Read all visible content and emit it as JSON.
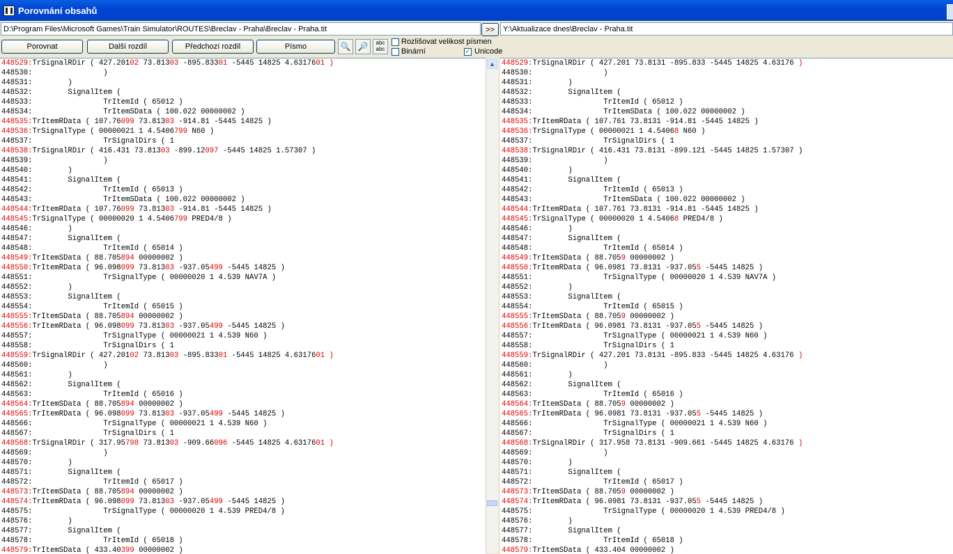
{
  "title": "Porovnání obsahů",
  "left_path": "D:\\Program Files\\Microsoft Games\\Train Simulator\\ROUTES\\Breclav - Praha\\Breclav - Praha.tit",
  "copy_button": ">>",
  "right_path": "Y:\\Aktualizace dnes\\Breclav - Praha.tit",
  "toolbar": {
    "compare": "Porovnat",
    "next_diff": "Další rozdíl",
    "prev_diff": "Předchozí rozdíl",
    "font": "Písmo",
    "case_sensitive_label": "Rozlišovat velikost písmen",
    "binary_label": "Binární",
    "unicode_label": "Unicode",
    "unicode_checked": true,
    "case_checked": false,
    "binary_checked": false
  },
  "icons": [
    "binoculars-icon",
    "binoculars-next-icon",
    "text-compare-icon"
  ],
  "left_lines": [
    [
      [
        "448529:",
        "d"
      ],
      [
        "TrSignalRDir ( 427.201",
        ""
      ],
      [
        "02",
        "d"
      ],
      [
        " 73.813",
        ""
      ],
      [
        "03",
        "d"
      ],
      [
        " -895.833",
        ""
      ],
      [
        "01",
        "d"
      ],
      [
        " -5445 14825 4.63176",
        ""
      ],
      [
        "01 )",
        "d"
      ]
    ],
    [
      [
        "448530:                ) ",
        ""
      ]
    ],
    [
      [
        "448531:        ) ",
        ""
      ]
    ],
    [
      [
        "448532:        SignalItem ( ",
        ""
      ]
    ],
    [
      [
        "448533:                TrItemId ( 65012 ) ",
        ""
      ]
    ],
    [
      [
        "448534:                TrItemSData ( 100.022 00000002 ) ",
        ""
      ]
    ],
    [
      [
        "448535:",
        "d"
      ],
      [
        "TrItemRData ( 107.76",
        ""
      ],
      [
        "099",
        "d"
      ],
      [
        " 73.813",
        ""
      ],
      [
        "03",
        "d"
      ],
      [
        " -914.81 -5445 14825 ) ",
        ""
      ]
    ],
    [
      [
        "448536:",
        "d"
      ],
      [
        "TrSignalType ( 00000021 1 4.5406",
        ""
      ],
      [
        "799",
        "d"
      ],
      [
        " N60 ) ",
        ""
      ]
    ],
    [
      [
        "448537:                TrSignalDirs ( 1",
        ""
      ]
    ],
    [
      [
        "448538:",
        "d"
      ],
      [
        "TrSignalRDir ( 416.431 73.813",
        ""
      ],
      [
        "03",
        "d"
      ],
      [
        " -899.12",
        ""
      ],
      [
        "097",
        "d"
      ],
      [
        " -5445 14825 1.57307 ) ",
        ""
      ]
    ],
    [
      [
        "448539:                ) ",
        ""
      ]
    ],
    [
      [
        "448540:        ) ",
        ""
      ]
    ],
    [
      [
        "448541:        SignalItem ( ",
        ""
      ]
    ],
    [
      [
        "448542:                TrItemId ( 65013 ) ",
        ""
      ]
    ],
    [
      [
        "448543:                TrItemSData ( 100.022 00000002 ) ",
        ""
      ]
    ],
    [
      [
        "448544:",
        "d"
      ],
      [
        "TrItemRData ( 107.76",
        ""
      ],
      [
        "099",
        "d"
      ],
      [
        " 73.813",
        ""
      ],
      [
        "03",
        "d"
      ],
      [
        " -914.81 -5445 14825 ) ",
        ""
      ]
    ],
    [
      [
        "448545:",
        "d"
      ],
      [
        "TrSignalType ( 00000020 1 4.5406",
        ""
      ],
      [
        "799",
        "d"
      ],
      [
        " PRED4/8 ) ",
        ""
      ]
    ],
    [
      [
        "448546:        ) ",
        ""
      ]
    ],
    [
      [
        "448547:        SignalItem ( ",
        ""
      ]
    ],
    [
      [
        "448548:                TrItemId ( 65014 ) ",
        ""
      ]
    ],
    [
      [
        "448549:",
        "d"
      ],
      [
        "TrItemSData ( 88.705",
        ""
      ],
      [
        "894",
        "d"
      ],
      [
        " 00000002 ) ",
        ""
      ]
    ],
    [
      [
        "448550:",
        "d"
      ],
      [
        "TrItemRData ( 96.098",
        ""
      ],
      [
        "099",
        "d"
      ],
      [
        " 73.813",
        ""
      ],
      [
        "03",
        "d"
      ],
      [
        " -937.05",
        ""
      ],
      [
        "499",
        "d"
      ],
      [
        " -5445 14825 ) ",
        ""
      ]
    ],
    [
      [
        "448551:                TrSignalType ( 00000020 1 4.539 NAV7A ) ",
        ""
      ]
    ],
    [
      [
        "448552:        ) ",
        ""
      ]
    ],
    [
      [
        "448553:        SignalItem ( ",
        ""
      ]
    ],
    [
      [
        "448554:                TrItemId ( 65015 ) ",
        ""
      ]
    ],
    [
      [
        "448555:",
        "d"
      ],
      [
        "TrItemSData ( 88.705",
        ""
      ],
      [
        "894",
        "d"
      ],
      [
        " 00000002 ) ",
        ""
      ]
    ],
    [
      [
        "448556:",
        "d"
      ],
      [
        "TrItemRData ( 96.098",
        ""
      ],
      [
        "099",
        "d"
      ],
      [
        " 73.813",
        ""
      ],
      [
        "03",
        "d"
      ],
      [
        " -937.05",
        ""
      ],
      [
        "499",
        "d"
      ],
      [
        " -5445 14825 ) ",
        ""
      ]
    ],
    [
      [
        "448557:                TrSignalType ( 00000021 1 4.539 N60 ) ",
        ""
      ]
    ],
    [
      [
        "448558:                TrSignalDirs ( 1",
        ""
      ]
    ],
    [
      [
        "448559:",
        "d"
      ],
      [
        "TrSignalRDir ( 427.201",
        ""
      ],
      [
        "02",
        "d"
      ],
      [
        " 73.813",
        ""
      ],
      [
        "03",
        "d"
      ],
      [
        " -895.833",
        ""
      ],
      [
        "01",
        "d"
      ],
      [
        " -5445 14825 4.63176",
        ""
      ],
      [
        "01 )",
        "d"
      ]
    ],
    [
      [
        "448560:                ) ",
        ""
      ]
    ],
    [
      [
        "448561:        ) ",
        ""
      ]
    ],
    [
      [
        "448562:        SignalItem ( ",
        ""
      ]
    ],
    [
      [
        "448563:                TrItemId ( 65016 ) ",
        ""
      ]
    ],
    [
      [
        "448564:",
        "d"
      ],
      [
        "TrItemSData ( 88.705",
        ""
      ],
      [
        "894",
        "d"
      ],
      [
        " 00000002 ) ",
        ""
      ]
    ],
    [
      [
        "448565:",
        "d"
      ],
      [
        "TrItemRData ( 96.098",
        ""
      ],
      [
        "099",
        "d"
      ],
      [
        " 73.813",
        ""
      ],
      [
        "03",
        "d"
      ],
      [
        " -937.05",
        ""
      ],
      [
        "499",
        "d"
      ],
      [
        " -5445 14825 ) ",
        ""
      ]
    ],
    [
      [
        "448566:                TrSignalType ( 00000021 1 4.539 N60 ) ",
        ""
      ]
    ],
    [
      [
        "448567:                TrSignalDirs ( 1",
        ""
      ]
    ],
    [
      [
        "448568:",
        "d"
      ],
      [
        "TrSignalRDir ( 317.95",
        ""
      ],
      [
        "798",
        "d"
      ],
      [
        " 73.813",
        ""
      ],
      [
        "03",
        "d"
      ],
      [
        " -909.66",
        ""
      ],
      [
        "096",
        "d"
      ],
      [
        " -5445 14825 4.63176",
        ""
      ],
      [
        "01 )",
        "d"
      ]
    ],
    [
      [
        "448569:                ) ",
        ""
      ]
    ],
    [
      [
        "448570:        ) ",
        ""
      ]
    ],
    [
      [
        "448571:        SignalItem ( ",
        ""
      ]
    ],
    [
      [
        "448572:                TrItemId ( 65017 ) ",
        ""
      ]
    ],
    [
      [
        "448573:",
        "d"
      ],
      [
        "TrItemSData ( 88.705",
        ""
      ],
      [
        "894",
        "d"
      ],
      [
        " 00000002 ) ",
        ""
      ]
    ],
    [
      [
        "448574:",
        "d"
      ],
      [
        "TrItemRData ( 96.098",
        ""
      ],
      [
        "099",
        "d"
      ],
      [
        " 73.813",
        ""
      ],
      [
        "03",
        "d"
      ],
      [
        " -937.05",
        ""
      ],
      [
        "499",
        "d"
      ],
      [
        " -5445 14825 ) ",
        ""
      ]
    ],
    [
      [
        "448575:                TrSignalType ( 00000020 1 4.539 PRED4/8 ) ",
        ""
      ]
    ],
    [
      [
        "448576:        ) ",
        ""
      ]
    ],
    [
      [
        "448577:        SignalItem ( ",
        ""
      ]
    ],
    [
      [
        "448578:                TrItemId ( 65018 ) ",
        ""
      ]
    ],
    [
      [
        "448579:",
        "d"
      ],
      [
        "TrItemSData ( 433.40",
        ""
      ],
      [
        "399",
        "d"
      ],
      [
        " 00000002 ) ",
        ""
      ]
    ]
  ],
  "right_lines": [
    [
      [
        "448529:",
        "d"
      ],
      [
        "TrSignalRDir ( 427.201 73.8131 -895.833 -5445 14825 4.63176 ",
        ""
      ],
      [
        ")",
        "d"
      ]
    ],
    [
      [
        "448530:                ) ",
        ""
      ]
    ],
    [
      [
        "448531:        ) ",
        ""
      ]
    ],
    [
      [
        "448532:        SignalItem ( ",
        ""
      ]
    ],
    [
      [
        "448533:                TrItemId ( 65012 ) ",
        ""
      ]
    ],
    [
      [
        "448534:                TrItemSData ( 100.022 00000002 ) ",
        ""
      ]
    ],
    [
      [
        "448535:",
        "d"
      ],
      [
        "TrItemRData ( 107.761 73.8131 -914.81 -5445 14825 ) ",
        ""
      ]
    ],
    [
      [
        "448536:",
        "d"
      ],
      [
        "TrSignalType ( 00000021 1 4.5406",
        ""
      ],
      [
        "8",
        "d"
      ],
      [
        " N60 ) ",
        ""
      ]
    ],
    [
      [
        "448537:                TrSignalDirs ( 1",
        ""
      ]
    ],
    [
      [
        "448538:",
        "d"
      ],
      [
        "TrSignalRDir ( 416.431 73.8131 -899.121 -5445 14825 1.57307 ) ",
        ""
      ]
    ],
    [
      [
        "448539:                ) ",
        ""
      ]
    ],
    [
      [
        "448540:        ) ",
        ""
      ]
    ],
    [
      [
        "448541:        SignalItem ( ",
        ""
      ]
    ],
    [
      [
        "448542:                TrItemId ( 65013 ) ",
        ""
      ]
    ],
    [
      [
        "448543:                TrItemSData ( 100.022 00000002 ) ",
        ""
      ]
    ],
    [
      [
        "448544:",
        "d"
      ],
      [
        "TrItemRData ( 107.761 73.8131 -914.81 -5445 14825 ) ",
        ""
      ]
    ],
    [
      [
        "448545:",
        "d"
      ],
      [
        "TrSignalType ( 00000020 1 4.5406",
        ""
      ],
      [
        "8",
        "d"
      ],
      [
        " PRED4/8 ) ",
        ""
      ]
    ],
    [
      [
        "448546:        ) ",
        ""
      ]
    ],
    [
      [
        "448547:        SignalItem ( ",
        ""
      ]
    ],
    [
      [
        "448548:                TrItemId ( 65014 ) ",
        ""
      ]
    ],
    [
      [
        "448549:",
        "d"
      ],
      [
        "TrItemSData ( 88.705",
        ""
      ],
      [
        "9",
        "d"
      ],
      [
        " 00000002 ) ",
        ""
      ]
    ],
    [
      [
        "448550:",
        "d"
      ],
      [
        "TrItemRData ( 96.0981 73.8131 -937.05",
        ""
      ],
      [
        "5",
        "d"
      ],
      [
        " -5445 14825 ) ",
        ""
      ]
    ],
    [
      [
        "448551:                TrSignalType ( 00000020 1 4.539 NAV7A ) ",
        ""
      ]
    ],
    [
      [
        "448552:        ) ",
        ""
      ]
    ],
    [
      [
        "448553:        SignalItem ( ",
        ""
      ]
    ],
    [
      [
        "448554:                TrItemId ( 65015 ) ",
        ""
      ]
    ],
    [
      [
        "448555:",
        "d"
      ],
      [
        "TrItemSData ( 88.705",
        ""
      ],
      [
        "9",
        "d"
      ],
      [
        " 00000002 ) ",
        ""
      ]
    ],
    [
      [
        "448556:",
        "d"
      ],
      [
        "TrItemRData ( 96.0981 73.8131 -937.05",
        ""
      ],
      [
        "5",
        "d"
      ],
      [
        " -5445 14825 ) ",
        ""
      ]
    ],
    [
      [
        "448557:                TrSignalType ( 00000021 1 4.539 N60 ) ",
        ""
      ]
    ],
    [
      [
        "448558:                TrSignalDirs ( 1",
        ""
      ]
    ],
    [
      [
        "448559:",
        "d"
      ],
      [
        "TrSignalRDir ( 427.201 73.8131 -895.833 -5445 14825 4.63176 ",
        ""
      ],
      [
        ")",
        "d"
      ]
    ],
    [
      [
        "448560:                ) ",
        ""
      ]
    ],
    [
      [
        "448561:        ) ",
        ""
      ]
    ],
    [
      [
        "448562:        SignalItem ( ",
        ""
      ]
    ],
    [
      [
        "448563:                TrItemId ( 65016 ) ",
        ""
      ]
    ],
    [
      [
        "448564:",
        "d"
      ],
      [
        "TrItemSData ( 88.705",
        ""
      ],
      [
        "9",
        "d"
      ],
      [
        " 00000002 ) ",
        ""
      ]
    ],
    [
      [
        "448565:",
        "d"
      ],
      [
        "TrItemRData ( 96.0981 73.8131 -937.05",
        ""
      ],
      [
        "5",
        "d"
      ],
      [
        " -5445 14825 ) ",
        ""
      ]
    ],
    [
      [
        "448566:                TrSignalType ( 00000021 1 4.539 N60 ) ",
        ""
      ]
    ],
    [
      [
        "448567:                TrSignalDirs ( 1",
        ""
      ]
    ],
    [
      [
        "448568:",
        "d"
      ],
      [
        "TrSignalRDir ( 317.958 73.8131 -909.661 -5445 14825 4.63176 ",
        ""
      ],
      [
        ")",
        "d"
      ]
    ],
    [
      [
        "448569:                ) ",
        ""
      ]
    ],
    [
      [
        "448570:        ) ",
        ""
      ]
    ],
    [
      [
        "448571:        SignalItem ( ",
        ""
      ]
    ],
    [
      [
        "448572:                TrItemId ( 65017 ) ",
        ""
      ]
    ],
    [
      [
        "448573:",
        "d"
      ],
      [
        "TrItemSData ( 88.705",
        ""
      ],
      [
        "9",
        "d"
      ],
      [
        " 00000002 ) ",
        ""
      ]
    ],
    [
      [
        "448574:",
        "d"
      ],
      [
        "TrItemRData ( 96.0981 73.8131 -937.05",
        ""
      ],
      [
        "5",
        "d"
      ],
      [
        " -5445 14825 ) ",
        ""
      ]
    ],
    [
      [
        "448575:                TrSignalType ( 00000020 1 4.539 PRED4/8 ) ",
        ""
      ]
    ],
    [
      [
        "448576:        ) ",
        ""
      ]
    ],
    [
      [
        "448577:        SignalItem ( ",
        ""
      ]
    ],
    [
      [
        "448578:                TrItemId ( 65018 ) ",
        ""
      ]
    ],
    [
      [
        "448579:",
        "d"
      ],
      [
        "TrItemSData ( 433.404 00000002 ) ",
        ""
      ]
    ]
  ]
}
